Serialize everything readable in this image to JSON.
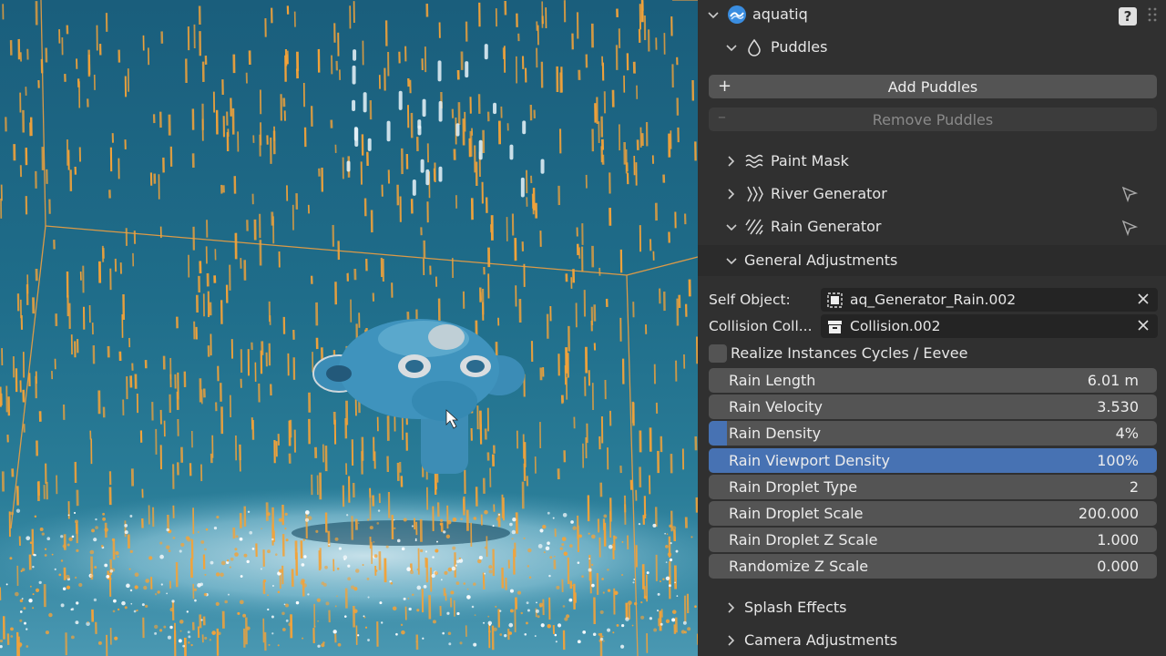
{
  "addon": {
    "name": "aquatiq",
    "help_label": "?"
  },
  "puddles": {
    "label": "Puddles",
    "add_label": "Add Puddles",
    "remove_label": "Remove Puddles"
  },
  "generators": [
    {
      "label": "Paint Mask",
      "expanded": false
    },
    {
      "label": "River Generator",
      "expanded": false
    },
    {
      "label": "Rain Generator",
      "expanded": true
    }
  ],
  "general": {
    "label": "General Adjustments",
    "self_object": {
      "label": "Self Object:",
      "value": "aq_Generator_Rain.002"
    },
    "collision": {
      "label": "Collision Coll...",
      "value": "Collision.002"
    },
    "realize_label": "Realize Instances Cycles / Eevee",
    "realize_checked": false,
    "sliders": [
      {
        "label": "Rain Length",
        "value": "6.01 m",
        "fill": 0
      },
      {
        "label": "Rain Velocity",
        "value": "3.530",
        "fill": 0
      },
      {
        "label": "Rain Density",
        "value": "4%",
        "fill": 0.04
      },
      {
        "label": "Rain Viewport Density",
        "value": "100%",
        "fill": 1.0
      },
      {
        "label": "Rain Droplet Type",
        "value": "2",
        "fill": 0
      },
      {
        "label": "Rain Droplet Scale",
        "value": "200.000",
        "fill": 0
      },
      {
        "label": "Rain Droplet Z Scale",
        "value": "1.000",
        "fill": 0
      },
      {
        "label": "Randomize Z Scale",
        "value": "0.000",
        "fill": 0
      }
    ]
  },
  "footer_panels": [
    {
      "label": "Splash Effects"
    },
    {
      "label": "Camera Adjustments"
    }
  ],
  "colors": {
    "accent": "#4772b3",
    "rain": "#f2a33a",
    "viewport_bg": "#1f6d8a",
    "panel_bg": "#303030"
  }
}
